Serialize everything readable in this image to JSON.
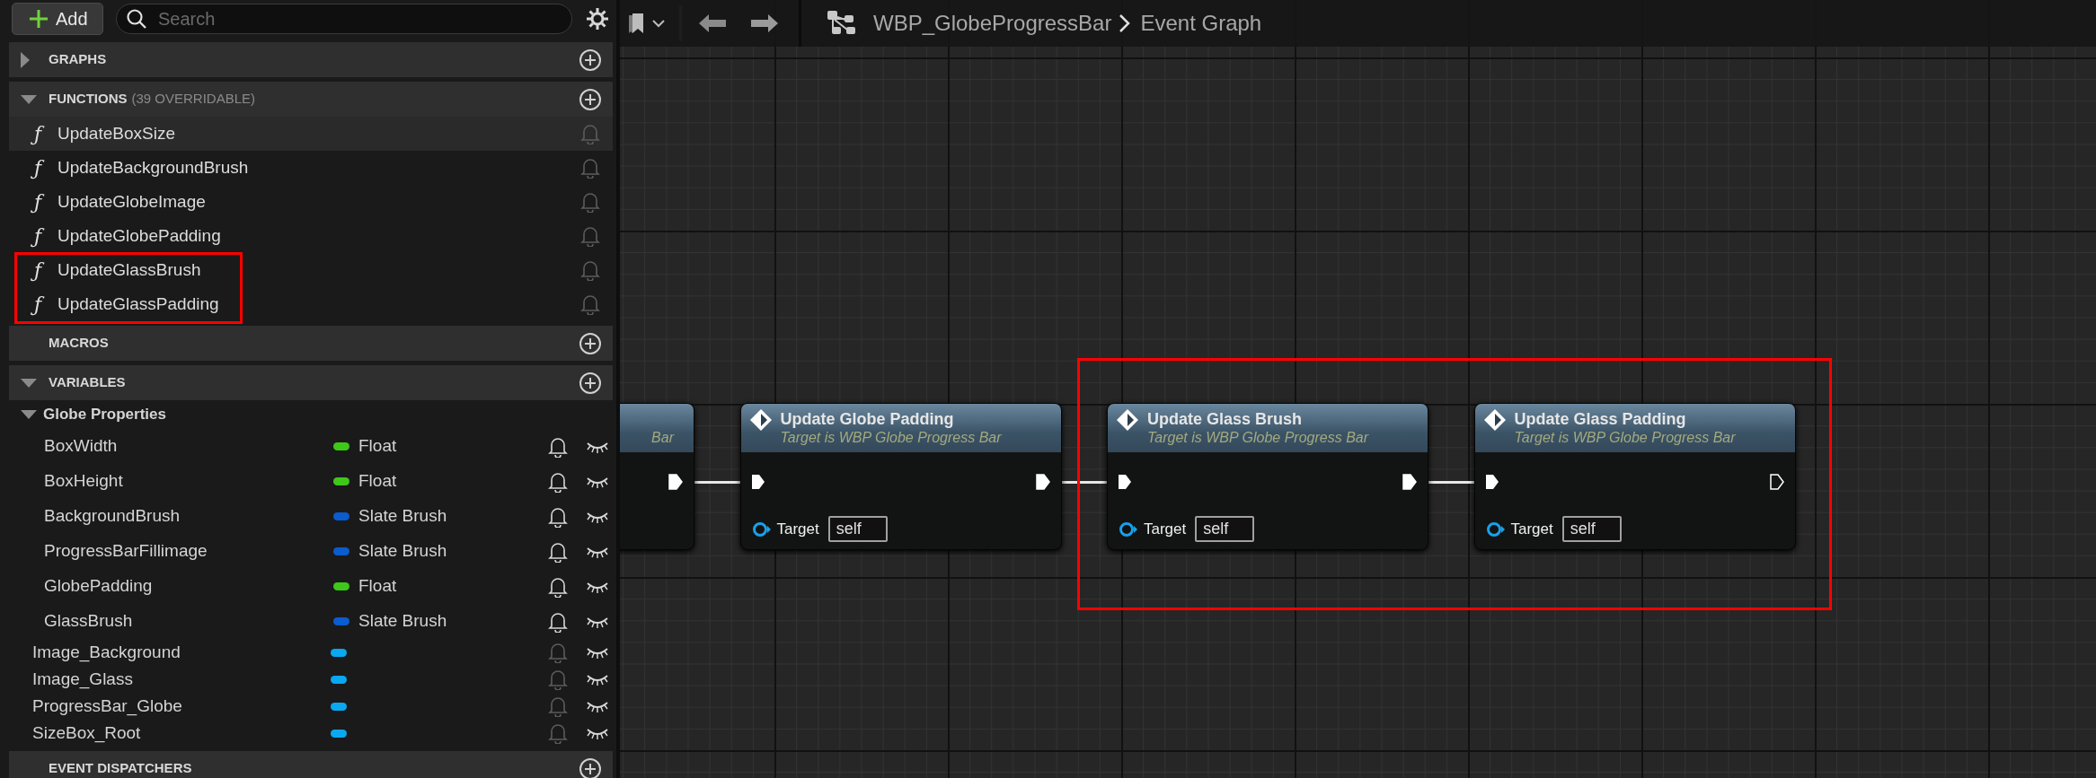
{
  "my_blueprint": {
    "add_button": "Add",
    "search": {
      "placeholder": "Search"
    },
    "sections": [
      {
        "title": "GRAPHS",
        "expanded": false
      },
      {
        "title": "FUNCTIONS",
        "note": "(39 OVERRIDABLE)",
        "expanded": true,
        "functions": [
          {
            "icon": "ƒ",
            "name": "UpdateBoxSize",
            "selected": true,
            "annotated": false
          },
          {
            "icon": "ƒ",
            "name": "UpdateBackgroundBrush",
            "selected": false,
            "annotated": false
          },
          {
            "icon": "ƒ",
            "name": "UpdateGlobeImage",
            "selected": false,
            "annotated": false
          },
          {
            "icon": "ƒ",
            "name": "UpdateGlobePadding",
            "selected": false,
            "annotated": false
          },
          {
            "icon": "ƒ",
            "name": "UpdateGlassBrush",
            "selected": false,
            "annotated": true
          },
          {
            "icon": "ƒ",
            "name": "UpdateGlassPadding",
            "selected": false,
            "annotated": true
          }
        ]
      },
      {
        "title": "MACROS"
      },
      {
        "title": "VARIABLES",
        "expanded": true,
        "categories": [
          {
            "name": "Globe Properties",
            "expanded": true,
            "variables": [
              {
                "kind": "property",
                "name": "BoxWidth",
                "type": "Float",
                "color": "#3ec81a"
              },
              {
                "kind": "property",
                "name": "BoxHeight",
                "type": "Float",
                "color": "#3ec81a"
              },
              {
                "kind": "property",
                "name": "BackgroundBrush",
                "type": "Slate Brush",
                "color": "#0a5ccf"
              },
              {
                "kind": "property",
                "name": "ProgressBarFillimage",
                "type": "Slate Brush",
                "color": "#0a5ccf"
              },
              {
                "kind": "property",
                "name": "GlobePadding",
                "type": "Float",
                "color": "#3ec81a"
              },
              {
                "kind": "property",
                "name": "GlassBrush",
                "type": "Slate Brush",
                "color": "#0a5ccf"
              }
            ]
          }
        ],
        "variables": [
          {
            "kind": "widget",
            "name": "Image_Background",
            "color": "#0aa8f0"
          },
          {
            "kind": "widget",
            "name": "Image_Glass",
            "color": "#0aa8f0"
          },
          {
            "kind": "widget",
            "name": "ProgressBar_Globe",
            "color": "#0aa8f0"
          },
          {
            "kind": "widget",
            "name": "SizeBox_Root",
            "color": "#0aa8f0"
          }
        ]
      },
      {
        "title": "EVENT DISPATCHERS"
      }
    ]
  },
  "graph": {
    "breadcrumb": [
      "WBP_GlobeProgressBar",
      "Event Graph"
    ],
    "nodes": [
      {
        "kind": "partial",
        "subtitle": "Bar",
        "exec_out_connected": true,
        "annotated": false
      },
      {
        "kind": "function",
        "title": "Update Globe Padding",
        "subtitle": "Target is WBP Globe Progress Bar",
        "target_label": "Target",
        "target_value": "self",
        "exec_out_connected": true,
        "annotated": false
      },
      {
        "kind": "function",
        "title": "Update Glass Brush",
        "subtitle": "Target is WBP Globe Progress Bar",
        "target_label": "Target",
        "target_value": "self",
        "exec_out_connected": true,
        "annotated": true
      },
      {
        "kind": "function",
        "title": "Update Glass Padding",
        "subtitle": "Target is WBP Globe Progress Bar",
        "target_label": "Target",
        "target_value": "self",
        "exec_out_connected": false,
        "annotated": true
      }
    ]
  }
}
